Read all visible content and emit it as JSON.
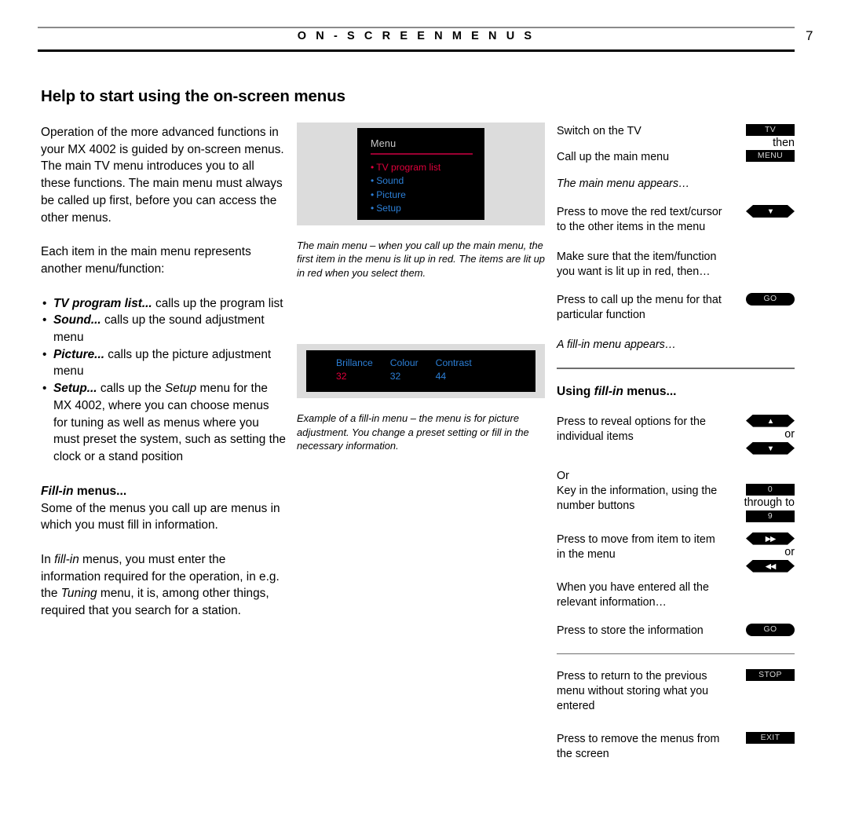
{
  "header": {
    "title": "O N - S C R E E N   M E N U S",
    "page_number": "7"
  },
  "doc_title": "Help to start using the on-screen menus",
  "left_column": {
    "para1": "Operation of the more advanced functions in your MX 4002 is guided by on-screen menus. The main TV menu introduces you to all these functions. The main menu must always be called up first, before you can access the other menus.",
    "para2": "Each item in the main menu represents another menu/function:",
    "bullets": [
      {
        "term": "TV program list...",
        "rest": " calls up the program list"
      },
      {
        "term": "Sound...",
        "rest": " calls up the sound adjustment menu"
      },
      {
        "term": "Picture...",
        "rest": " calls up the picture adjustment menu"
      },
      {
        "term": "Setup...",
        "rest_a": " calls up the ",
        "emph": "Setup",
        "rest_b": " menu for the MX 4002, where you can choose menus for tuning as well as menus where you must preset the system, such as setting the clock or a stand position"
      }
    ],
    "subheading_a": "Fill-in",
    "subheading_b": " menus...",
    "para3": "Some of the menus you call up are menus in which you must fill in information.",
    "para4_a": "In ",
    "para4_emph1": "fill-in",
    "para4_b": " menus, you must enter the information required for the operation, in e.g. the ",
    "para4_emph2": "Tuning",
    "para4_c": " menu, it is, among other things, required that you search for a station."
  },
  "middle_column": {
    "main_menu_screen": {
      "title": "Menu",
      "items": [
        {
          "bullet": "•",
          "label": "TV program list",
          "color": "#e1003c"
        },
        {
          "bullet": "•",
          "label": "Sound",
          "color": "#2c7fd6"
        },
        {
          "bullet": "•",
          "label": "Picture",
          "color": "#2c7fd6"
        },
        {
          "bullet": "•",
          "label": "Setup",
          "color": "#2c7fd6"
        }
      ]
    },
    "main_menu_caption": "The main menu – when you call up the main menu, the first item in the menu is lit up in red. The items are lit up in red when you select them.",
    "fillin_screen": {
      "headers": [
        "Brillance",
        "Colour",
        "Contrast"
      ],
      "values": [
        "32",
        "32",
        "44"
      ],
      "header_color": "#2c7fd6",
      "value_colors": [
        "#e1003c",
        "#2c7fd6",
        "#2c7fd6"
      ]
    },
    "fillin_caption": "Example of a fill-in menu – the menu is for picture adjustment. You change a preset setting or fill in the necessary information."
  },
  "right_column": {
    "steps": [
      {
        "text": "Switch on the TV",
        "button": "TV",
        "button_style": "rect",
        "note": "then"
      },
      {
        "text": "Call up the main menu",
        "button": "MENU",
        "button_style": "rect"
      },
      {
        "text": "The main menu appears…",
        "italic": true
      },
      {
        "text": "Press to move the red text/cursor to the other items in the menu",
        "button_style": "hex",
        "glyph": "▼",
        "glyph_name": "arrow-down-icon"
      },
      {
        "text": "Make sure that the item/function you want is lit up in red, then…"
      },
      {
        "text": "Press to call up the menu for that particular function",
        "button": "GO",
        "button_style": "pill"
      },
      {
        "text": "A fill-in menu appears…",
        "italic": true
      }
    ],
    "section_heading_a": "Using ",
    "section_heading_emph": "fill-in",
    "section_heading_b": " menus...",
    "steps2": [
      {
        "text": "Press to reveal options for the individual items",
        "button_style": "hex-pair",
        "glyph_top": "▲",
        "glyph_bottom": "▼",
        "note": "or"
      },
      {
        "text": "Or\nKey in the information, using the number buttons",
        "button_style": "rect-pair",
        "button_top": "0",
        "button_bottom": "9",
        "note": "through to"
      },
      {
        "text": "Press to move from item to item in the menu",
        "button_style": "hex-pair",
        "glyph_top": "▶▶",
        "glyph_bottom": "◀◀",
        "note": "or"
      },
      {
        "text": "When you have entered all the relevant information…"
      },
      {
        "text": "Press to store the information",
        "button": "GO",
        "button_style": "pill"
      }
    ],
    "steps3": [
      {
        "text": "Press to return to the previous menu without storing what you entered",
        "button": "STOP",
        "button_style": "rect"
      },
      {
        "text": "Press to remove the menus from the screen",
        "button": "EXIT",
        "button_style": "rect"
      }
    ]
  }
}
